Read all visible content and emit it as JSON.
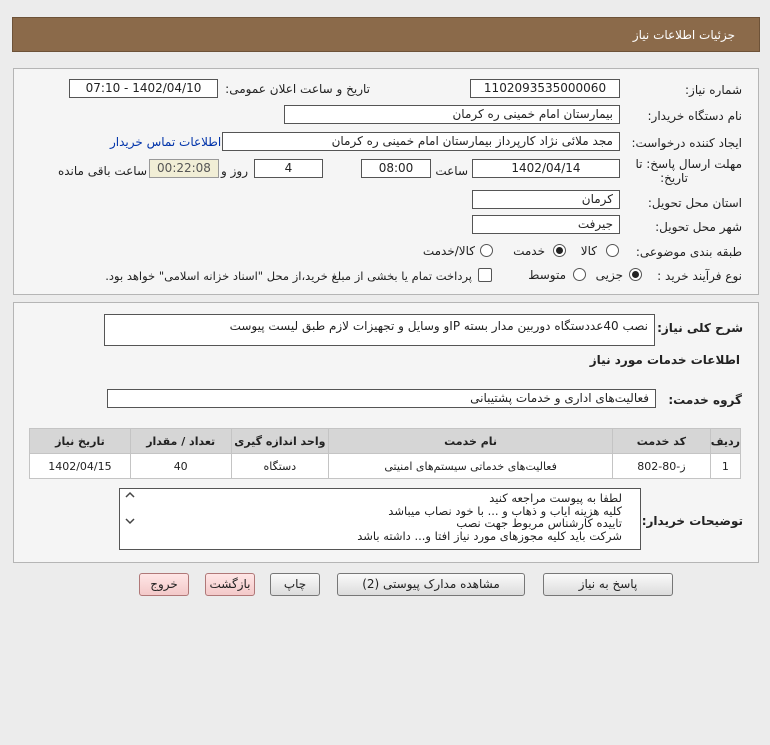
{
  "header": {
    "title": "جزئیات اطلاعات نیاز"
  },
  "form": {
    "need_number_label": "شماره نیاز:",
    "need_number": "1102093535000060",
    "announce_label": "تاریخ و ساعت اعلان عمومی:",
    "announce_value": "1402/04/10 - 07:10",
    "buyer_org_label": "نام دستگاه خریدار:",
    "buyer_org": "بیمارستان امام خمینی  ره  کرمان",
    "requester_label": "ایجاد کننده درخواست:",
    "requester": "مجد ملائی نژاد کارپرداز بیمارستان امام خمینی  ره  کرمان",
    "contact_link": "اطلاعات تماس خریدار",
    "deadline_label_1": "مهلت ارسال پاسخ: تا",
    "deadline_label_2": "تاریخ:",
    "deadline_date": "1402/04/14",
    "time_label": "ساعت",
    "deadline_time": "08:00",
    "days_value": "4",
    "days_label": "روز و",
    "remaining_time": "00:22:08",
    "remaining_label": "ساعت باقی مانده",
    "province_label": "استان محل تحویل:",
    "province": "کرمان",
    "city_label": "شهر محل تحویل:",
    "city": "جیرفت",
    "category_label": "طبقه بندی موضوعی:",
    "category_options": [
      "کالا",
      "خدمت",
      "کالا/خدمت"
    ],
    "category_selected": "خدمت",
    "process_label": "نوع فرآیند خرید :",
    "process_options": [
      "جزیی",
      "متوسط"
    ],
    "process_selected": "جزیی",
    "payment_note": "پرداخت تمام یا بخشی از مبلغ خرید،از محل \"اسناد خزانه اسلامی\" خواهد بود."
  },
  "description": {
    "label": "شرح کلی نیاز:",
    "text": "نصب 40عددستگاه دوربین مدار بسته IPو وسایل و تجهیزات لازم طبق لیست پیوست"
  },
  "services": {
    "section_title": "اطلاعات خدمات مورد نیاز",
    "group_label": "گروه خدمت:",
    "group_value": "فعالیت‌های اداری و خدمات پشتیبانی",
    "table": {
      "headers": [
        "ردیف",
        "کد خدمت",
        "نام خدمت",
        "واحد اندازه گیری",
        "تعداد / مقدار",
        "تاریخ نیاز"
      ],
      "rows": [
        [
          "1",
          "ز-80-802",
          "فعالیت‌های خدماتی سیستم‌های امنیتی",
          "دستگاه",
          "40",
          "1402/04/15"
        ]
      ]
    }
  },
  "buyer_notes": {
    "label": "توضیحات خریدار:",
    "lines": [
      "لطفا به پیوست مراجعه کنید",
      "کلیه هزینه ایاب و ذهاب و ... با خود نصاب میباشد",
      "تاییده کارشناس مربوط جهت نصب",
      "شرکت باید کلیه مجوزهای مورد نیاز افتا و... داشته باشد"
    ]
  },
  "buttons": {
    "respond": "پاسخ به نیاز",
    "attachments": "مشاهده مدارک پیوستی (2)",
    "print": "چاپ",
    "back": "بازگشت",
    "exit": "خروج"
  },
  "colors": {
    "header_bg": "#8b6a4a",
    "link": "#0033aa",
    "timer_bg": "#f1eed6"
  }
}
